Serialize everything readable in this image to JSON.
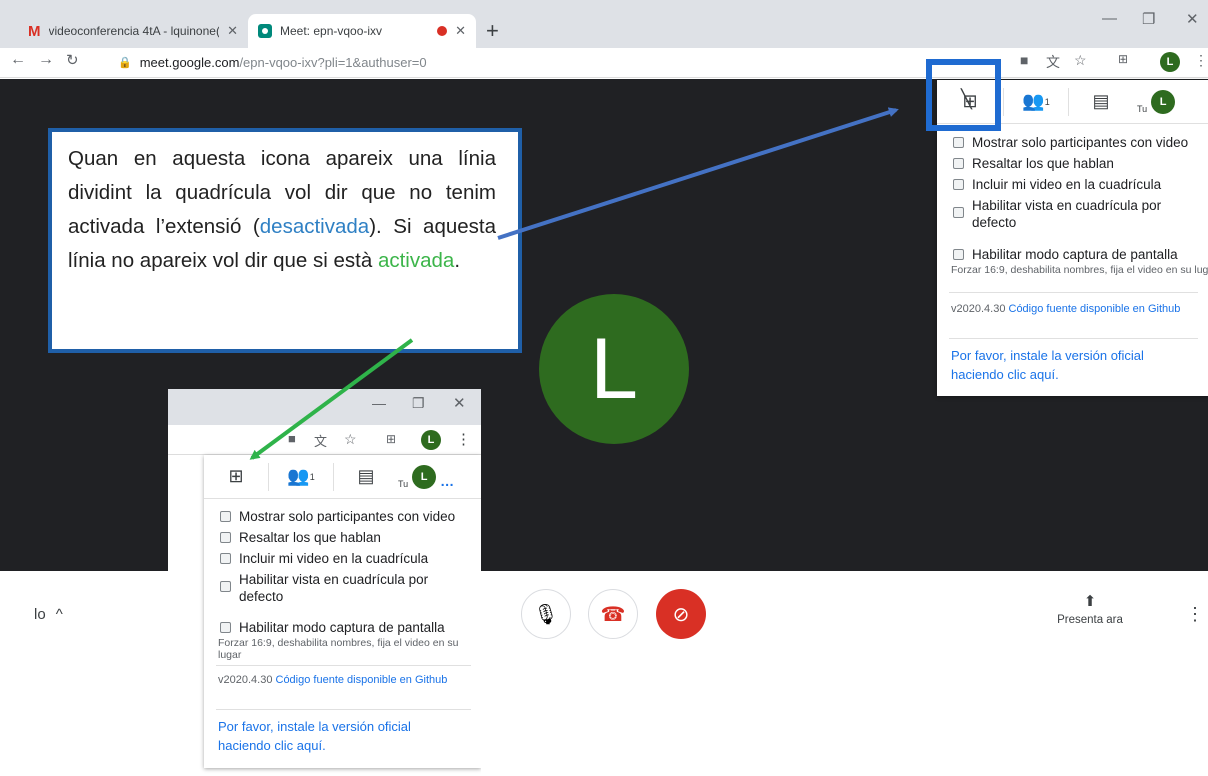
{
  "browser": {
    "tabs": [
      {
        "title": "videoconferencia 4tA - lquinone(",
        "icon": "gmail-icon"
      },
      {
        "title": "Meet: epn-vqoo-ixv",
        "icon": "meet-icon",
        "recording": true
      }
    ],
    "url_host": "meet.google.com",
    "url_path": "/epn-vqoo-ixv?pli=1&authuser=0",
    "profile_initial": "L"
  },
  "meet": {
    "avatar_initial": "L",
    "left_label": "lo",
    "present_label": "Presenta ara"
  },
  "extension_panel": {
    "you_label": "Tu",
    "participant_count": "1",
    "options": [
      "Mostrar solo participantes con video",
      "Resaltar los que hablan",
      "Incluir mi video en la cuadrícula",
      "Habilitar vista en cuadrícula por defecto",
      "Habilitar modo captura de pantalla"
    ],
    "capture_note": "Forzar 16:9, deshabilita nombres, fija el video en su lugar",
    "version": "v2020.4.30",
    "source_link": "Código fuente disponible en Github",
    "install_cta": "Por favor, instale la versión oficial haciendo clic aquí."
  },
  "annotation": {
    "text_part1": "Quan en aquesta icona apareix una línia dividint la quadrícula vol dir que no tenim activada l’extensió (",
    "word_deactivated": "desactivada",
    "text_part2": "). Si aquesta línia no apareix vol dir que si està ",
    "word_activated": "activada",
    "text_part3": ".",
    "colors": {
      "box": "#1f5fa8",
      "deactivated": "#2f80c4",
      "activated": "#3cb54a",
      "arrow_blue": "#4472c4",
      "arrow_green": "#2fb34a"
    }
  }
}
